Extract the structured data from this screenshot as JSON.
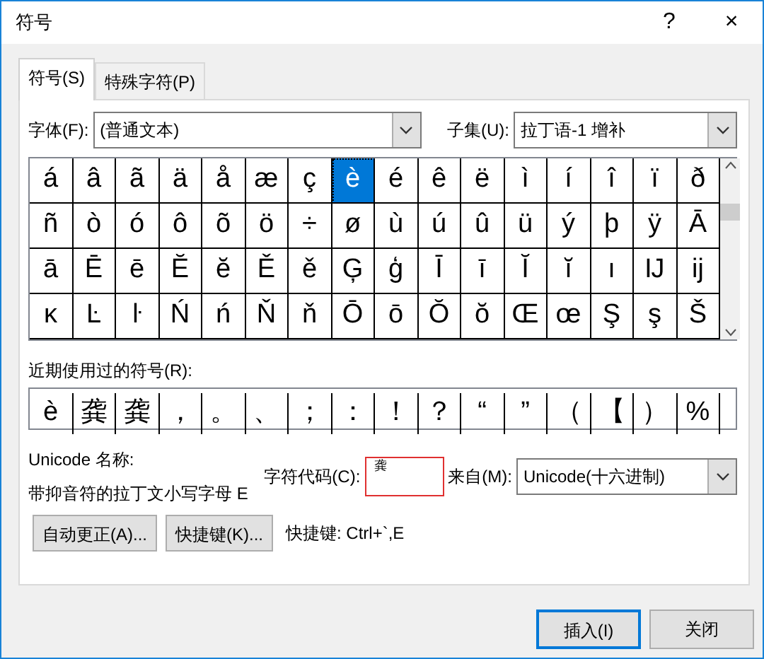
{
  "window": {
    "title": "符号",
    "help": "?",
    "close": "×"
  },
  "tabs": [
    {
      "label": "符号(S)",
      "selected": true
    },
    {
      "label": "特殊字符(P)",
      "selected": false
    }
  ],
  "font": {
    "label": "字体(F):",
    "value": "(普通文本)"
  },
  "subset": {
    "label": "子集(U):",
    "value": "拉丁语-1 增补"
  },
  "characters": [
    {
      "char": "á",
      "selected": false
    },
    {
      "char": "â",
      "selected": false
    },
    {
      "char": "ã",
      "selected": false
    },
    {
      "char": "ä",
      "selected": false
    },
    {
      "char": "å",
      "selected": false
    },
    {
      "char": "æ",
      "selected": false
    },
    {
      "char": "ç",
      "selected": false
    },
    {
      "char": "è",
      "selected": true
    },
    {
      "char": "é",
      "selected": false
    },
    {
      "char": "ê",
      "selected": false
    },
    {
      "char": "ë",
      "selected": false
    },
    {
      "char": "ì",
      "selected": false
    },
    {
      "char": "í",
      "selected": false
    },
    {
      "char": "î",
      "selected": false
    },
    {
      "char": "ï",
      "selected": false
    },
    {
      "char": "ð",
      "selected": false
    },
    {
      "char": "ñ",
      "selected": false
    },
    {
      "char": "ò",
      "selected": false
    },
    {
      "char": "ó",
      "selected": false
    },
    {
      "char": "ô",
      "selected": false
    },
    {
      "char": "õ",
      "selected": false
    },
    {
      "char": "ö",
      "selected": false
    },
    {
      "char": "÷",
      "selected": false
    },
    {
      "char": "ø",
      "selected": false
    },
    {
      "char": "ù",
      "selected": false
    },
    {
      "char": "ú",
      "selected": false
    },
    {
      "char": "û",
      "selected": false
    },
    {
      "char": "ü",
      "selected": false
    },
    {
      "char": "ý",
      "selected": false
    },
    {
      "char": "þ",
      "selected": false
    },
    {
      "char": "ÿ",
      "selected": false
    },
    {
      "char": "Ā",
      "selected": false
    },
    {
      "char": "ā",
      "selected": false
    },
    {
      "char": "Ē",
      "selected": false
    },
    {
      "char": "ē",
      "selected": false
    },
    {
      "char": "Ĕ",
      "selected": false
    },
    {
      "char": "ĕ",
      "selected": false
    },
    {
      "char": "Ě",
      "selected": false
    },
    {
      "char": "ě",
      "selected": false
    },
    {
      "char": "Ģ",
      "selected": false
    },
    {
      "char": "ģ",
      "selected": false
    },
    {
      "char": "Ī",
      "selected": false
    },
    {
      "char": "ī",
      "selected": false
    },
    {
      "char": "Ĭ",
      "selected": false
    },
    {
      "char": "ĭ",
      "selected": false
    },
    {
      "char": "ı",
      "selected": false
    },
    {
      "char": "Ĳ",
      "selected": false
    },
    {
      "char": "ĳ",
      "selected": false
    },
    {
      "char": "ĸ",
      "selected": false
    },
    {
      "char": "Ŀ",
      "selected": false
    },
    {
      "char": "ŀ",
      "selected": false
    },
    {
      "char": "Ń",
      "selected": false
    },
    {
      "char": "ń",
      "selected": false
    },
    {
      "char": "Ň",
      "selected": false
    },
    {
      "char": "ň",
      "selected": false
    },
    {
      "char": "Ō",
      "selected": false
    },
    {
      "char": "ō",
      "selected": false
    },
    {
      "char": "Ŏ",
      "selected": false
    },
    {
      "char": "ŏ",
      "selected": false
    },
    {
      "char": "Œ",
      "selected": false
    },
    {
      "char": "œ",
      "selected": false
    },
    {
      "char": "Ş",
      "selected": false
    },
    {
      "char": "ş",
      "selected": false
    },
    {
      "char": "Š",
      "selected": false
    }
  ],
  "recent": {
    "label": "近期使用过的符号(R):",
    "symbols": [
      "è",
      "龚",
      "龚",
      "，",
      "。",
      "、",
      "；",
      "：",
      "！",
      "？",
      "“",
      "”",
      "（",
      "【",
      "）",
      "%"
    ]
  },
  "unicode_name": {
    "label": "Unicode 名称:",
    "value": "带抑音符的拉丁文小写字母 E"
  },
  "char_code": {
    "label": "字符代码(C):",
    "value": "龚",
    "annotation_outline": true
  },
  "from": {
    "label": "来自(M):",
    "value": "Unicode(十六进制)"
  },
  "buttons": [
    {
      "label": "自动更正(A)..."
    },
    {
      "label": "快捷键(K)..."
    }
  ],
  "shortcut": "快捷键: Ctrl+`,E",
  "footer_buttons": [
    {
      "label": "插入(I)",
      "default": true
    },
    {
      "label": "关闭",
      "default": false
    }
  ]
}
